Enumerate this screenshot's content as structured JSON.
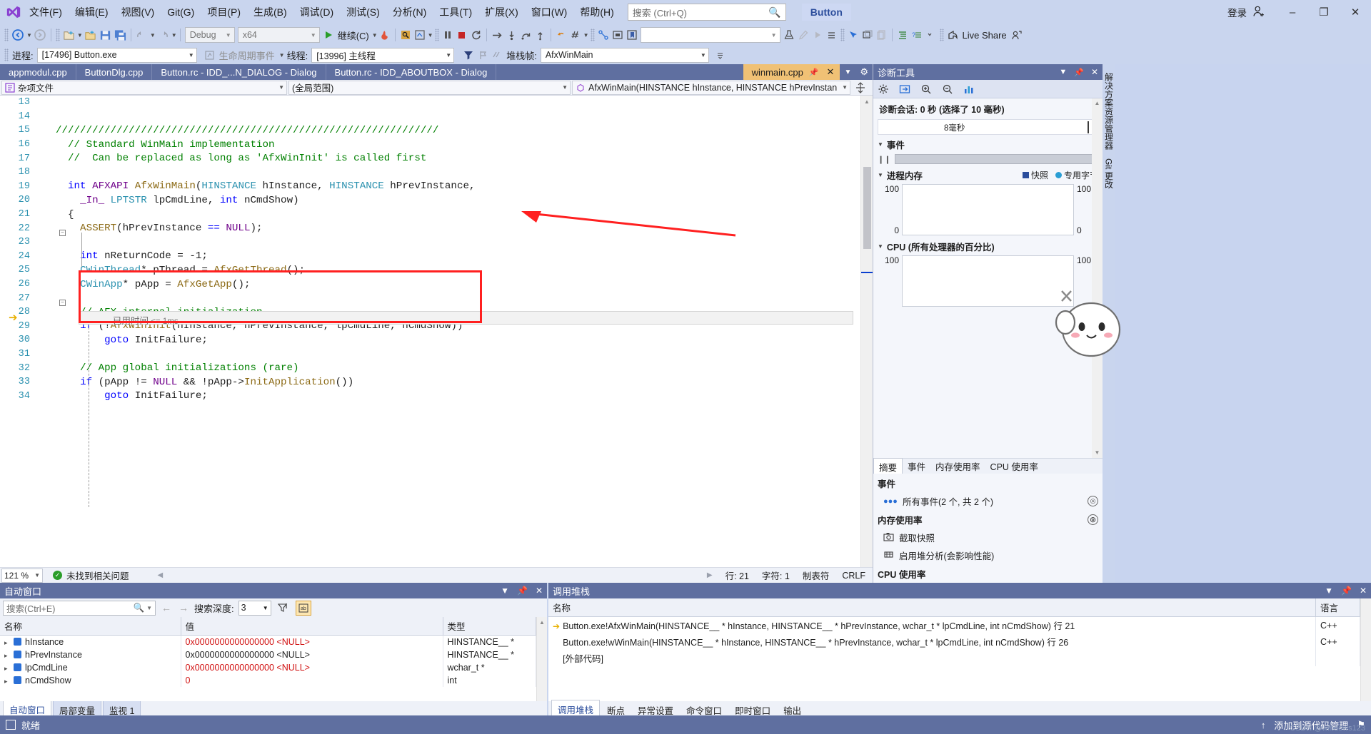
{
  "app": {
    "title": "Button",
    "signin_label": "登录",
    "live_share": "Live Share"
  },
  "menu": {
    "items": [
      "文件(F)",
      "编辑(E)",
      "视图(V)",
      "Git(G)",
      "项目(P)",
      "生成(B)",
      "调试(D)",
      "测试(S)",
      "分析(N)",
      "工具(T)",
      "扩展(X)",
      "窗口(W)",
      "帮助(H)"
    ]
  },
  "search": {
    "placeholder": "搜索 (Ctrl+Q)",
    "icon": "magnifier-icon"
  },
  "toolbar": {
    "config": "Debug",
    "platform": "x64",
    "continue_label": "继续(C)",
    "find_combo": "",
    "live_share": "Live Share"
  },
  "debugbar": {
    "process_label": "进程:",
    "process_value": "[17496] Button.exe",
    "lifecycle_label": "生命周期事件",
    "thread_label": "线程:",
    "thread_value": "[13996] 主线程",
    "stackframe_label": "堆栈帧:",
    "stackframe_value": "AfxWinMain"
  },
  "tabs": [
    {
      "label": "appmodul.cpp",
      "active": false
    },
    {
      "label": "ButtonDlg.cpp",
      "active": false
    },
    {
      "label": "Button.rc - IDD_...N_DIALOG - Dialog",
      "active": false
    },
    {
      "label": "Button.rc - IDD_ABOUTBOX - Dialog",
      "active": false
    },
    {
      "label": "winmain.cpp",
      "active": true
    }
  ],
  "navbar": {
    "project": "杂项文件",
    "scope": "(全局范围)",
    "member": "AfxWinMain(HINSTANCE hInstance, HINSTANCE hPrevInstan"
  },
  "editor": {
    "zoom": "121 %",
    "issues": "未找到相关问题",
    "line_label": "行: 21",
    "char_label": "字符: 1",
    "tabs_label": "制表符",
    "eol_label": "CRLF",
    "elapsed_tip_prefix": "已用时间",
    "elapsed_tip_value": "<= 1ms",
    "lines": [
      {
        "num": "13",
        "tokens": []
      },
      {
        "num": "14",
        "tokens": []
      },
      {
        "num": "15",
        "tokens": [
          {
            "c": "cmt",
            "t": "///////////////////////////////////////////////////////////////"
          }
        ]
      },
      {
        "num": "16",
        "tokens": [
          {
            "c": "cmt",
            "t": "  // Standard WinMain implementation"
          }
        ]
      },
      {
        "num": "17",
        "tokens": [
          {
            "c": "cmt",
            "t": "  //  Can be replaced as long as 'AfxWinInit' is called first"
          }
        ]
      },
      {
        "num": "18",
        "tokens": []
      },
      {
        "num": "19",
        "tokens": [
          {
            "c": "kw",
            "t": "  int "
          },
          {
            "c": "mac",
            "t": "AFXAPI "
          },
          {
            "c": "fn",
            "t": "AfxWinMain"
          },
          {
            "c": "pln",
            "t": "("
          },
          {
            "c": "typ",
            "t": "HINSTANCE"
          },
          {
            "c": "pln",
            "t": " hInstance, "
          },
          {
            "c": "typ",
            "t": "HINSTANCE"
          },
          {
            "c": "pln",
            "t": " hPrevInstance,"
          }
        ]
      },
      {
        "num": "20",
        "tokens": [
          {
            "c": "pln",
            "t": "    "
          },
          {
            "c": "mac",
            "t": "_In_ "
          },
          {
            "c": "typ",
            "t": "LPTSTR"
          },
          {
            "c": "pln",
            "t": " lpCmdLine, "
          },
          {
            "c": "kw",
            "t": "int"
          },
          {
            "c": "pln",
            "t": " nCmdShow)"
          }
        ]
      },
      {
        "num": "21",
        "tokens": [
          {
            "c": "pln",
            "t": "  {"
          }
        ]
      },
      {
        "num": "22",
        "tokens": [
          {
            "c": "fn",
            "t": "    ASSERT"
          },
          {
            "c": "pln",
            "t": "(hPrevInstance "
          },
          {
            "c": "kw",
            "t": "=="
          },
          {
            "c": "mac",
            "t": " NULL"
          },
          {
            "c": "pln",
            "t": ");"
          }
        ]
      },
      {
        "num": "23",
        "tokens": []
      },
      {
        "num": "24",
        "tokens": [
          {
            "c": "pln",
            "t": "    "
          },
          {
            "c": "kw",
            "t": "int"
          },
          {
            "c": "pln",
            "t": " nReturnCode = -1;"
          }
        ]
      },
      {
        "num": "25",
        "tokens": [
          {
            "c": "pln",
            "t": "    "
          },
          {
            "c": "typ",
            "t": "CWinThread"
          },
          {
            "c": "pln",
            "t": "* pThread = "
          },
          {
            "c": "fn",
            "t": "AfxGetThread"
          },
          {
            "c": "pln",
            "t": "();"
          }
        ]
      },
      {
        "num": "26",
        "tokens": [
          {
            "c": "pln",
            "t": "    "
          },
          {
            "c": "typ",
            "t": "CWinApp"
          },
          {
            "c": "pln",
            "t": "* pApp = "
          },
          {
            "c": "fn",
            "t": "AfxGetApp"
          },
          {
            "c": "pln",
            "t": "();"
          }
        ]
      },
      {
        "num": "27",
        "tokens": []
      },
      {
        "num": "28",
        "tokens": [
          {
            "c": "cmt",
            "t": "    // AFX internal initialization"
          }
        ]
      },
      {
        "num": "29",
        "tokens": [
          {
            "c": "pln",
            "t": "    "
          },
          {
            "c": "kw",
            "t": "if"
          },
          {
            "c": "pln",
            "t": " (!"
          },
          {
            "c": "fn",
            "t": "AfxWinInit"
          },
          {
            "c": "pln",
            "t": "(hInstance, hPrevInstance, lpCmdLine, nCmdShow))"
          }
        ]
      },
      {
        "num": "30",
        "tokens": [
          {
            "c": "pln",
            "t": "        "
          },
          {
            "c": "kw",
            "t": "goto"
          },
          {
            "c": "pln",
            "t": " InitFailure;"
          }
        ]
      },
      {
        "num": "31",
        "tokens": []
      },
      {
        "num": "32",
        "tokens": [
          {
            "c": "cmt",
            "t": "    // App global initializations (rare)"
          }
        ]
      },
      {
        "num": "33",
        "tokens": [
          {
            "c": "pln",
            "t": "    "
          },
          {
            "c": "kw",
            "t": "if"
          },
          {
            "c": "pln",
            "t": " (pApp != "
          },
          {
            "c": "mac",
            "t": "NULL"
          },
          {
            "c": "pln",
            "t": " && !pApp->"
          },
          {
            "c": "fn",
            "t": "InitApplication"
          },
          {
            "c": "pln",
            "t": "())"
          }
        ]
      },
      {
        "num": "34",
        "tokens": [
          {
            "c": "pln",
            "t": "        "
          },
          {
            "c": "kw",
            "t": "goto"
          },
          {
            "c": "pln",
            "t": " InitFailure;"
          }
        ]
      }
    ]
  },
  "diagnostics": {
    "title": "诊断工具",
    "session_label": "诊断会话: 0 秒 (选择了 10 毫秒)",
    "ruler_label": "8毫秒",
    "events_section": "事件",
    "memory_section": "进程内存",
    "memory_legend": [
      {
        "label": "快照",
        "color": "#2b4d9c"
      },
      {
        "label": "专用字节",
        "color": "#2a9ed4"
      }
    ],
    "memory_axis": {
      "max": "100",
      "min": "0",
      "max_r": "100",
      "min_r": "0"
    },
    "cpu_section": "CPU (所有处理器的百分比)",
    "cpu_axis": {
      "max": "100",
      "max_r": "100"
    },
    "tabs": [
      {
        "label": "摘要",
        "active": true
      },
      {
        "label": "事件",
        "active": false
      },
      {
        "label": "内存使用率",
        "active": false
      },
      {
        "label": "CPU 使用率",
        "active": false
      }
    ],
    "list": [
      {
        "type": "header",
        "label": "事件"
      },
      {
        "type": "row",
        "icon": "events-icon",
        "label": "所有事件(2 个, 共 2 个)"
      },
      {
        "type": "header",
        "label": "内存使用率"
      },
      {
        "type": "row",
        "icon": "camera-icon",
        "label": "截取快照"
      },
      {
        "type": "row",
        "icon": "heap-icon",
        "label": "启用堆分析(会影响性能)"
      },
      {
        "type": "header",
        "label": "CPU 使用率"
      }
    ]
  },
  "vtabs": [
    "解决方案资源管理器",
    "Git 更改"
  ],
  "autos": {
    "title": "自动窗口",
    "search_placeholder": "搜索(Ctrl+E)",
    "depth_label": "搜索深度:",
    "depth_value": "3",
    "columns": [
      "名称",
      "值",
      "类型"
    ],
    "rows": [
      {
        "name": "hInstance",
        "value": "0x0000000000000000 <NULL>",
        "type": "HINSTANCE__ *",
        "value_red": true
      },
      {
        "name": "hPrevInstance",
        "value": "0x0000000000000000 <NULL>",
        "type": "HINSTANCE__ *",
        "value_red": false
      },
      {
        "name": "lpCmdLine",
        "value": "0x0000000000000000 <NULL>",
        "type": "wchar_t *",
        "value_red": true
      },
      {
        "name": "nCmdShow",
        "value": "0",
        "type": "int",
        "value_red": true
      }
    ],
    "tabs": [
      {
        "label": "自动窗口",
        "active": true
      },
      {
        "label": "局部变量",
        "active": false
      },
      {
        "label": "监视 1",
        "active": false
      }
    ]
  },
  "callstack": {
    "title": "调用堆栈",
    "columns": [
      "名称",
      "语言"
    ],
    "rows": [
      {
        "current": true,
        "name": "Button.exe!AfxWinMain(HINSTANCE__ * hInstance, HINSTANCE__ * hPrevInstance, wchar_t * lpCmdLine, int nCmdShow) 行 21",
        "lang": "C++"
      },
      {
        "current": false,
        "name": "Button.exe!wWinMain(HINSTANCE__ * hInstance, HINSTANCE__ * hPrevInstance, wchar_t * lpCmdLine, int nCmdShow) 行 26",
        "lang": "C++"
      },
      {
        "current": false,
        "name": "[外部代码]",
        "lang": ""
      }
    ],
    "tabs": [
      {
        "label": "调用堆栈",
        "active": true
      },
      {
        "label": "断点",
        "active": false
      },
      {
        "label": "异常设置",
        "active": false
      },
      {
        "label": "命令窗口",
        "active": false
      },
      {
        "label": "即时窗口",
        "active": false
      },
      {
        "label": "输出",
        "active": false
      }
    ]
  },
  "statusbar": {
    "state": "就绪",
    "source_control": "添加到源代码管理",
    "watermark": "CSDN @windows123"
  },
  "colors": {
    "chrome": "#c9d5ee",
    "panel_title": "#5f6fa0",
    "active_tab": "#f0c175",
    "accent_red": "#ff2020",
    "value_red": "#d11111",
    "linenum": "#2b91af"
  }
}
